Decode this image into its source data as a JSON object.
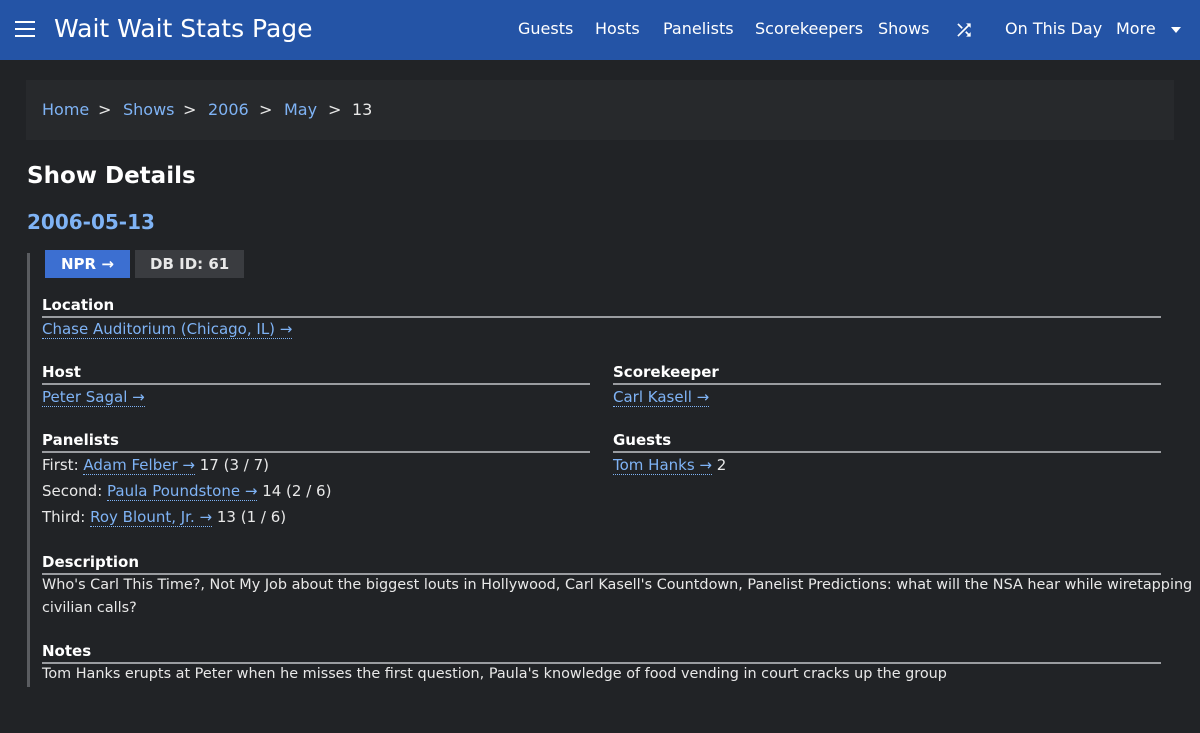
{
  "nav": {
    "brand": "Wait Wait Stats Page",
    "items": [
      "Guests",
      "Hosts",
      "Panelists",
      "Scorekeepers",
      "Shows"
    ],
    "on_this_day": "On This Day",
    "more": "More"
  },
  "breadcrumb": {
    "items": [
      "Home",
      "Shows",
      "2006",
      "May"
    ],
    "current": "13",
    "separator": ">"
  },
  "page": {
    "title": "Show Details",
    "date": "2006-05-13",
    "npr_badge": "NPR →",
    "db_badge": "DB ID: 61"
  },
  "location": {
    "heading": "Location",
    "value": "Chase Auditorium (Chicago, IL) →"
  },
  "host": {
    "heading": "Host",
    "value": "Peter Sagal →"
  },
  "scorekeeper": {
    "heading": "Scorekeeper",
    "value": "Carl Kasell →"
  },
  "panelists": {
    "heading": "Panelists",
    "rows": [
      {
        "place": "First:",
        "name": "Adam Felber →",
        "score": "17 (3 / 7)"
      },
      {
        "place": "Second:",
        "name": "Paula Poundstone →",
        "score": "14 (2 / 6)"
      },
      {
        "place": "Third:",
        "name": "Roy Blount, Jr. →",
        "score": "13 (1 / 6)"
      }
    ]
  },
  "guests": {
    "heading": "Guests",
    "name": "Tom Hanks →",
    "score": "2"
  },
  "description": {
    "heading": "Description",
    "line1": "Who's Carl This Time?, Not My Job about the biggest louts in Hollywood, Carl Kasell's Countdown, Panelist Predictions: what will the NSA hear while wiretapping",
    "line2": "civilian calls?"
  },
  "notes": {
    "heading": "Notes",
    "text": "Tom Hanks erupts at Peter when he misses the first question, Paula's knowledge of food vending in court cracks up the group"
  },
  "colors": {
    "topbar": "#2454a6",
    "background": "#212326",
    "link": "#7fb3f5",
    "npr_badge": "#3c6fd1"
  }
}
